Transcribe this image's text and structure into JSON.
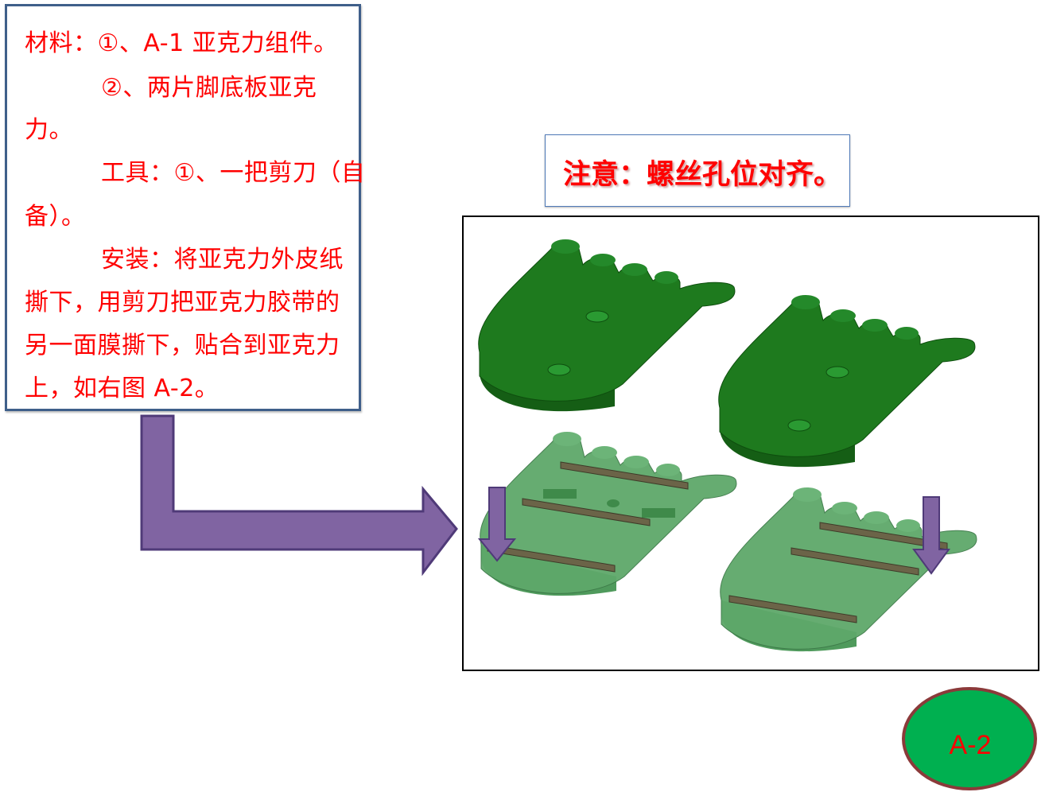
{
  "instructions": {
    "lines": [
      "材料：①、A-1 亚克力组件。",
      "②、两片脚底板亚克",
      "力。",
      "工具：①、一把剪刀（自",
      "备）。",
      "安装：将亚克力外皮纸",
      "撕下，用剪刀把亚克力胶带的",
      "另一面膜撕下，贴合到亚克力",
      "上，如右图 A-2。"
    ]
  },
  "note": {
    "text": "注意：螺丝孔位对齐。"
  },
  "badge": {
    "label": "A-2"
  },
  "colors": {
    "text_red": "#ff0000",
    "foot_dark": "#1e7a1e",
    "foot_light": "#5ea86a",
    "tape": "#6b6448",
    "arrow_purple": "#8064a2",
    "badge_fill": "#00b050",
    "badge_border": "#8b3a3a"
  }
}
